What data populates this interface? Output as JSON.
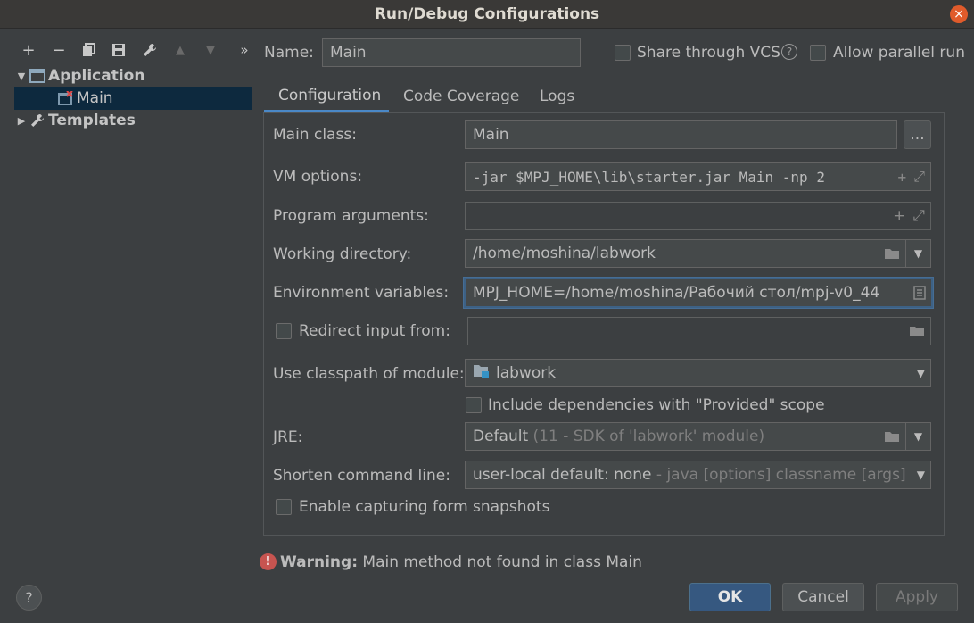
{
  "window": {
    "title": "Run/Debug Configurations",
    "close_glyph": "×"
  },
  "toolbar": {
    "add": "+",
    "remove": "−",
    "more": "»",
    "icons": [
      "plus-icon",
      "minus-icon",
      "copy-icon",
      "save-icon",
      "wrench-icon",
      "arrow-up-icon",
      "arrow-down-icon",
      "double-chevron-icon"
    ]
  },
  "tree": {
    "items": [
      {
        "label": "Application",
        "expanded": true
      },
      {
        "label": "Main",
        "selected": true
      },
      {
        "label": "Templates",
        "expanded": false
      }
    ]
  },
  "header": {
    "name_label": "Name:",
    "name_value": "Main",
    "share_vcs_label": "Share through VCS",
    "help_glyph": "?",
    "allow_parallel_label": "Allow parallel run"
  },
  "tabs": [
    {
      "label": "Configuration",
      "active": true
    },
    {
      "label": "Code Coverage"
    },
    {
      "label": "Logs"
    }
  ],
  "form": {
    "main_class_label": "Main class:",
    "main_class_value": "Main",
    "browse_label": "...",
    "vm_options_label": "VM options:",
    "vm_options_value": "-jar $MPJ_HOME\\lib\\starter.jar Main -np 2",
    "program_args_label": "Program arguments:",
    "program_args_value": "",
    "working_dir_label": "Working directory:",
    "working_dir_value": "/home/moshina/labwork",
    "env_vars_label": "Environment variables:",
    "env_vars_value": "MPJ_HOME=/home/moshina/Рабочий стол/mpj-v0_44",
    "redirect_label": "Redirect input from:",
    "redirect_value": "",
    "classpath_label": "Use classpath of module:",
    "classpath_value": "labwork",
    "include_deps_label": "Include dependencies with \"Provided\" scope",
    "jre_label": "JRE:",
    "jre_value": "Default",
    "jre_detail": "(11 - SDK of 'labwork' module)",
    "shorten_label": "Shorten command line:",
    "shorten_value": "user-local default: none",
    "shorten_detail": "- java [options] classname [args]",
    "snapshots_label": "Enable capturing form snapshots"
  },
  "warning": {
    "prefix": "Warning:",
    "text": "Main method not found in class Main"
  },
  "footer": {
    "help_glyph": "?",
    "ok": "OK",
    "cancel": "Cancel",
    "apply": "Apply"
  },
  "colors": {
    "accent": "#4a88c7",
    "selection": "#0d293e",
    "error": "#c75450",
    "primary_button": "#365880"
  }
}
